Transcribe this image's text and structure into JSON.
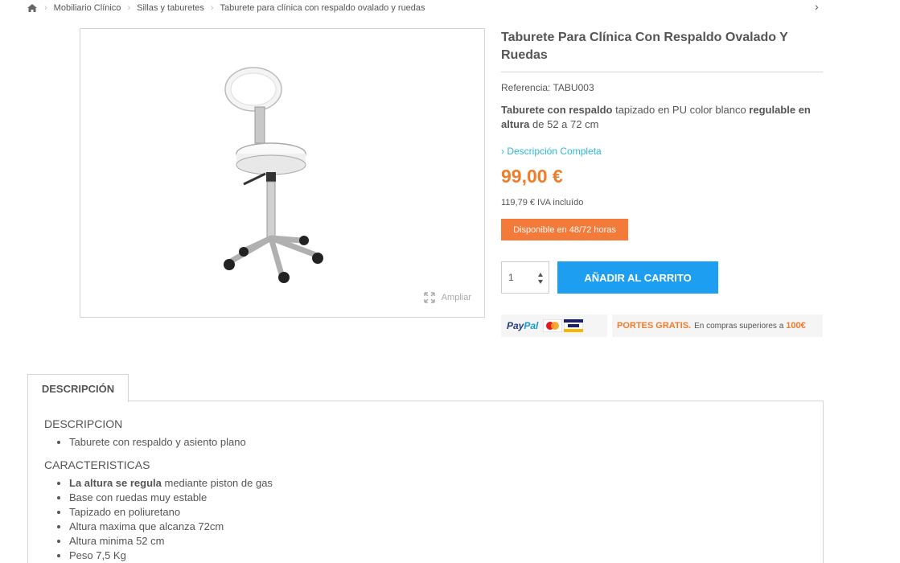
{
  "breadcrumb": {
    "home_icon": "home-icon",
    "items": [
      "Mobiliario Clínico",
      "Sillas y taburetes",
      "Taburete para clínica con respaldo ovalado y ruedas"
    ]
  },
  "product": {
    "title": "Taburete Para Clínica Con Respaldo Ovalado Y Ruedas",
    "reference_label": "Referencia: TABU003",
    "short_desc": {
      "bold1": "Taburete con respaldo",
      "text1": " tapizado en PU color blanco ",
      "bold2": "regulable en altura",
      "text2": " de 52 a 72 cm"
    },
    "more_link": "Descripción Completa",
    "price": "99,00 €",
    "tax_price": "119,79 € IVA incluído",
    "availability": "Disponible en 48/72 horas",
    "quantity": "1",
    "add_to_cart": "AÑADIR AL CARRITO",
    "enlarge": "Ampliar"
  },
  "payment": {
    "paypal_a": "Pay",
    "paypal_b": "Pal"
  },
  "shipping": {
    "strong": "PORTES GRATIS.",
    "text": "En compras superiores a",
    "amount": "100€"
  },
  "colors": {
    "accent_orange": "#f17c2a",
    "button_blue": "#1e9ef1",
    "link_blue": "#2fb5d2"
  },
  "tabs": {
    "description_label": "DESCRIPCIÓN"
  },
  "description": {
    "section1_title": "DESCRIPCION",
    "section1_items": [
      "Taburete con respaldo y asiento plano"
    ],
    "section2_title": "CARACTERISTICAS",
    "section2_items": [
      {
        "bold": "La altura se regula",
        "text": " mediante piston de gas"
      },
      {
        "bold": "",
        "text": "Base con ruedas muy estable"
      },
      {
        "bold": "",
        "text": "Tapizado en poliuretano"
      },
      {
        "bold": "",
        "text": "Altura maxima que alcanza 72cm"
      },
      {
        "bold": "",
        "text": "Altura minima 52 cm"
      },
      {
        "bold": "",
        "text": "Peso 7,5 Kg"
      }
    ]
  }
}
